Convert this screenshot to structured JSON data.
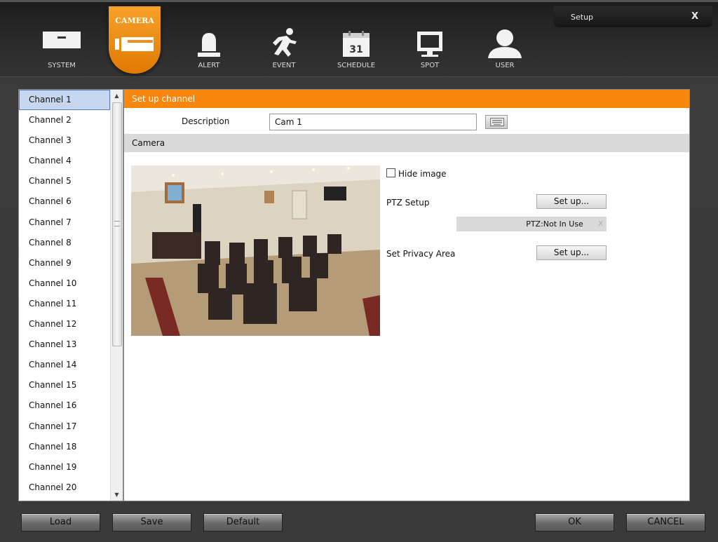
{
  "window": {
    "title": "Setup",
    "close_label": "X"
  },
  "toolbar": {
    "tabs": [
      {
        "label": "SYSTEM",
        "icon": "system-icon"
      },
      {
        "label": "CAMERA",
        "icon": "camera-icon",
        "active": true
      },
      {
        "label": "ALERT",
        "icon": "alert-icon"
      },
      {
        "label": "EVENT",
        "icon": "event-icon"
      },
      {
        "label": "SCHEDULE",
        "icon": "calendar-icon",
        "icon_text": "31"
      },
      {
        "label": "SPOT",
        "icon": "monitor-icon"
      },
      {
        "label": "USER",
        "icon": "user-icon"
      }
    ]
  },
  "channels": {
    "selected": "Channel 1",
    "items": [
      "Channel 1",
      "Channel 2",
      "Channel 3",
      "Channel 4",
      "Channel 5",
      "Channel 6",
      "Channel 7",
      "Channel 8",
      "Channel 9",
      "Channel 10",
      "Channel 11",
      "Channel 12",
      "Channel 13",
      "Channel 14",
      "Channel 15",
      "Channel 16",
      "Channel 17",
      "Channel 18",
      "Channel 19",
      "Channel 20"
    ]
  },
  "setup": {
    "header": "Set up channel",
    "description_label": "Description",
    "description_value": "Cam 1",
    "camera_header": "Camera",
    "hide_image_label": "Hide image",
    "hide_image_checked": false,
    "ptz_label": "PTZ Setup",
    "ptz_button": "Set up...",
    "ptz_status": "PTZ:Not In Use",
    "ptz_clear": "X",
    "privacy_label": "Set Privacy Area",
    "privacy_button": "Set up..."
  },
  "buttons": {
    "load": "Load",
    "save": "Save",
    "default": "Default",
    "ok": "OK",
    "cancel": "CANCEL"
  },
  "colors": {
    "accent": "#f7860d",
    "selection": "#c6d7ef",
    "section_gray": "#d9d9d9"
  }
}
